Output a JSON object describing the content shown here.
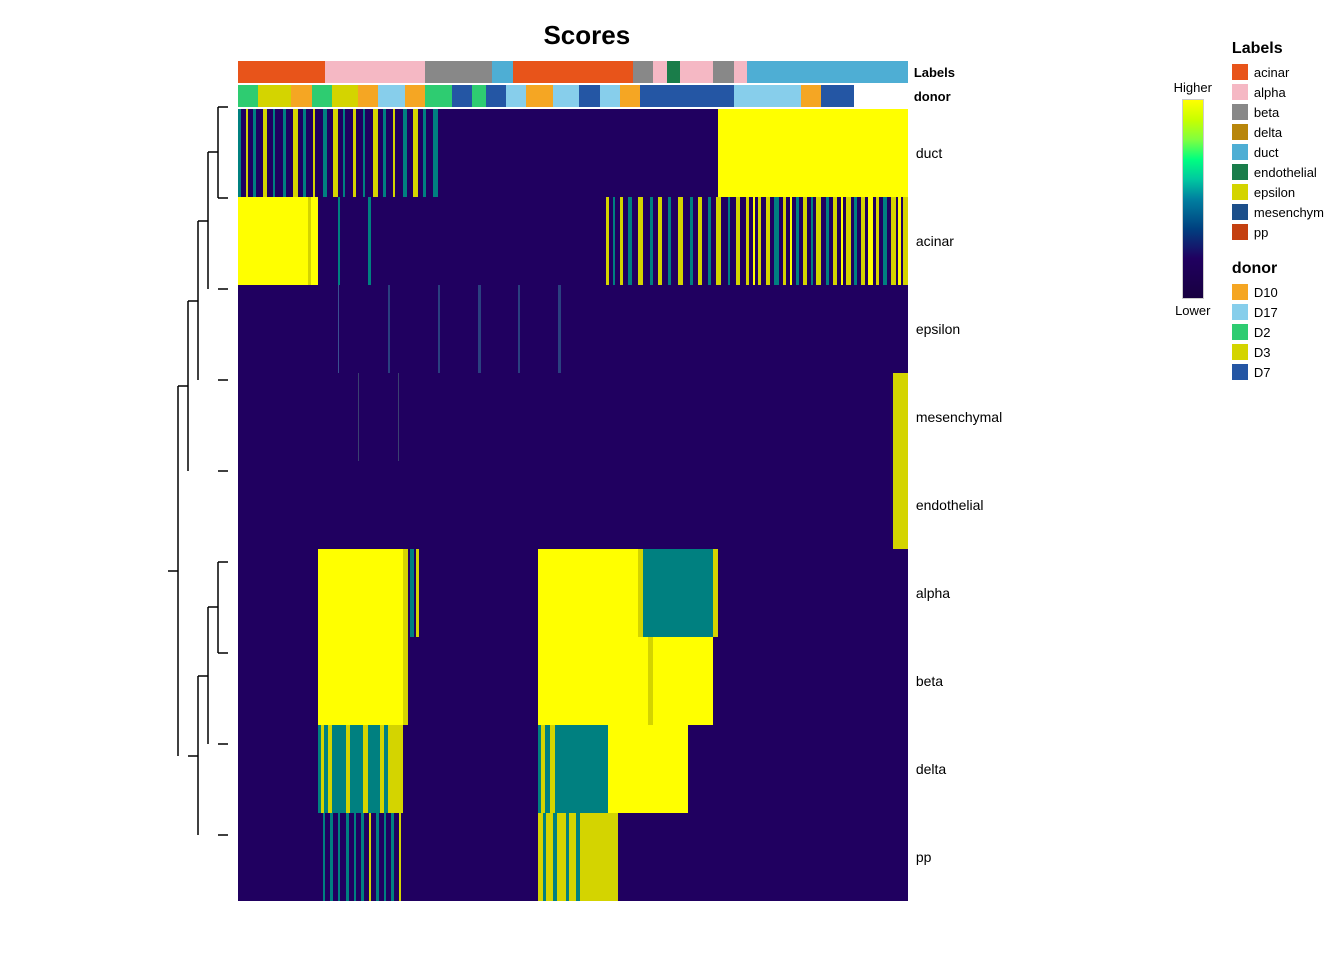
{
  "title": "Scores",
  "colorbar": {
    "higher_label": "Higher",
    "lower_label": "Lower"
  },
  "row_labels": [
    "duct",
    "acinar",
    "epsilon",
    "mesenchymal",
    "endothelial",
    "alpha",
    "beta",
    "delta",
    "pp"
  ],
  "annotation_bar1_label": "Labels",
  "annotation_bar2_label": "donor",
  "labels_legend_title": "Labels",
  "labels_legend": [
    {
      "name": "acinar",
      "color": "#e8541a"
    },
    {
      "name": "alpha",
      "color": "#f5b8c4"
    },
    {
      "name": "beta",
      "color": "#888888"
    },
    {
      "name": "delta",
      "color": "#b8860b"
    },
    {
      "name": "duct",
      "color": "#4eaed4"
    },
    {
      "name": "endothelial",
      "color": "#1a7d4a"
    },
    {
      "name": "epsilon",
      "color": "#d4d400"
    },
    {
      "name": "mesenchym",
      "color": "#1c4f8a"
    },
    {
      "name": "pp",
      "color": "#c44010"
    }
  ],
  "donor_legend_title": "donor",
  "donor_legend": [
    {
      "name": "D10",
      "color": "#f5a623"
    },
    {
      "name": "D17",
      "color": "#87ceeb"
    },
    {
      "name": "D2",
      "color": "#2ecc71"
    },
    {
      "name": "D3",
      "color": "#d4d400"
    },
    {
      "name": "D7",
      "color": "#2456a4"
    }
  ]
}
